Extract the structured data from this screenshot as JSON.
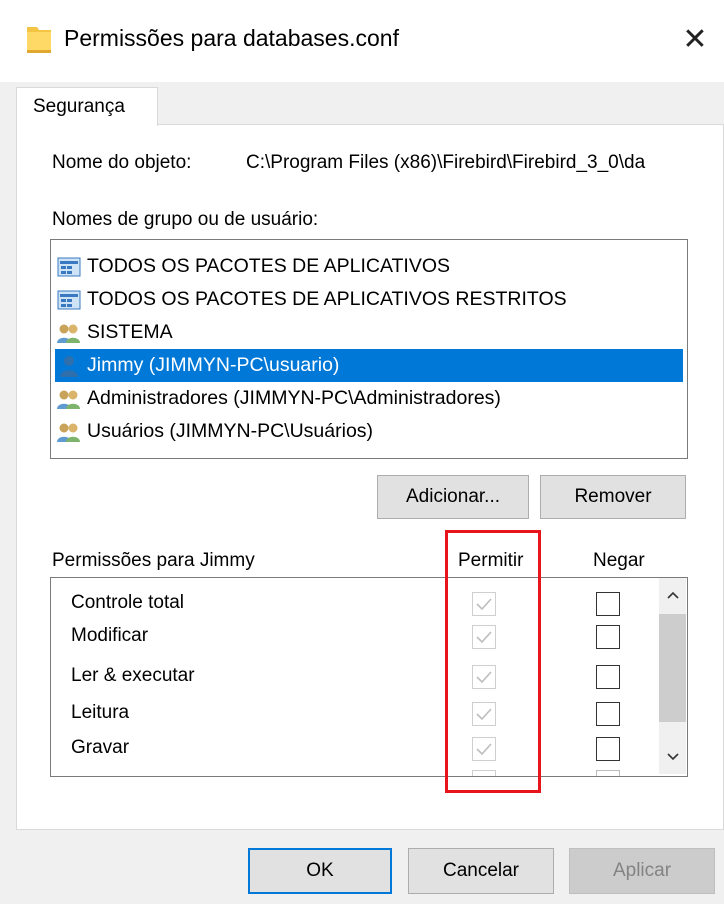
{
  "window": {
    "title": "Permissões para databases.conf",
    "close_icon": "close-icon"
  },
  "tabs": [
    {
      "label": "Segurança",
      "active": true
    }
  ],
  "object": {
    "label": "Nome do objeto:",
    "value": "C:\\Program Files (x86)\\Firebird\\Firebird_3_0\\da"
  },
  "groups": {
    "label": "Nomes de grupo ou de usuário:",
    "items": [
      {
        "label": "TODOS OS PACOTES DE APLICATIVOS",
        "icon": "app-package-icon",
        "selected": false
      },
      {
        "label": "TODOS OS PACOTES DE APLICATIVOS RESTRITOS",
        "icon": "app-package-icon",
        "selected": false
      },
      {
        "label": "SISTEMA",
        "icon": "group-users-icon",
        "selected": false
      },
      {
        "label": "Jimmy (JIMMYN-PC\\usuario)",
        "icon": "single-user-icon",
        "selected": true
      },
      {
        "label": "Administradores (JIMMYN-PC\\Administradores)",
        "icon": "group-users-icon",
        "selected": false
      },
      {
        "label": "Usuários (JIMMYN-PC\\Usuários)",
        "icon": "group-users-icon",
        "selected": false
      }
    ]
  },
  "buttons": {
    "add": "Adicionar...",
    "remove": "Remover",
    "ok": "OK",
    "cancel": "Cancelar",
    "apply": "Aplicar"
  },
  "permissions": {
    "label": "Permissões para Jimmy",
    "allow_header": "Permitir",
    "deny_header": "Negar",
    "rows": [
      {
        "name": "Controle total",
        "allow": true,
        "allow_disabled": true,
        "deny": false
      },
      {
        "name": "Modificar",
        "allow": true,
        "allow_disabled": true,
        "deny": false
      },
      {
        "name": "Ler & executar",
        "allow": true,
        "allow_disabled": true,
        "deny": false
      },
      {
        "name": "Leitura",
        "allow": true,
        "allow_disabled": true,
        "deny": false
      },
      {
        "name": "Gravar",
        "allow": true,
        "allow_disabled": true,
        "deny": false
      }
    ]
  },
  "colors": {
    "selection": "#0078d7",
    "highlight_box": "#e8141b",
    "dialog_bg": "#f0f0f0"
  }
}
